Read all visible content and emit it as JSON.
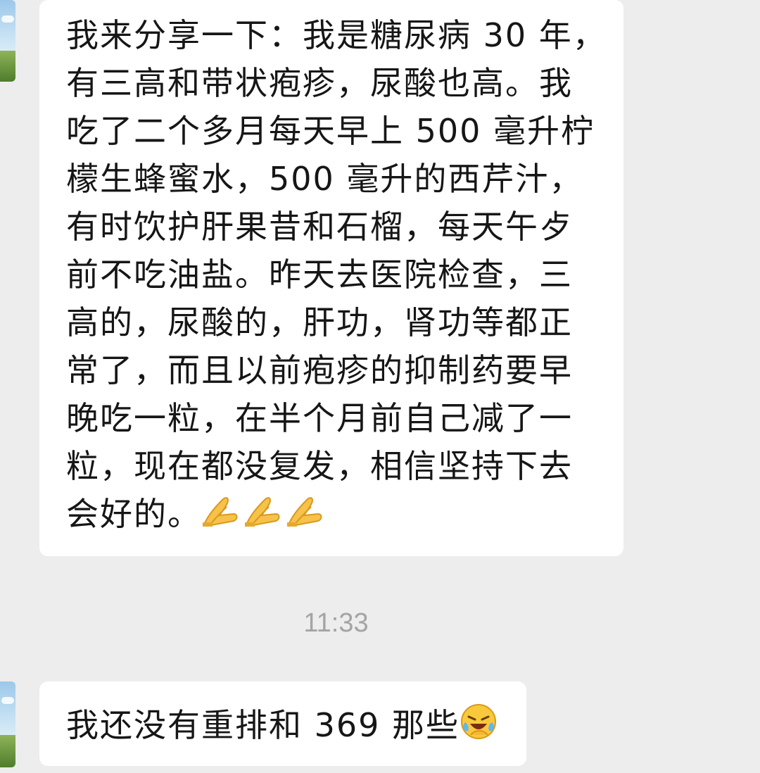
{
  "messages": [
    {
      "lines": [
        "我来分享一下：我是糖尿病 30 年，",
        "有三高和带状疱疹，尿酸也高。我",
        "吃了二个多月每天早上 500 毫升柠",
        "檬生蜂蜜水，500 毫升的西芹汁，",
        "有时饮护肝果昔和石榴，每天午歺",
        "前不吃油盐。昨天去医院检查，三",
        "高的，尿酸的，肝功，肾功等都正",
        "常了，而且以前疱疹的抑制药要早",
        "晚吃一粒，在半个月前自己减了一",
        "粒，现在都没复发，相信坚持下去",
        "会好的。"
      ],
      "emojis": [
        "folded-hands-icon",
        "folded-hands-icon",
        "folded-hands-icon"
      ]
    },
    {
      "text": "我还没有重排和 369 那些",
      "emojis": [
        "laughing-crying-face-icon"
      ]
    }
  ],
  "timestamp": "11:33"
}
